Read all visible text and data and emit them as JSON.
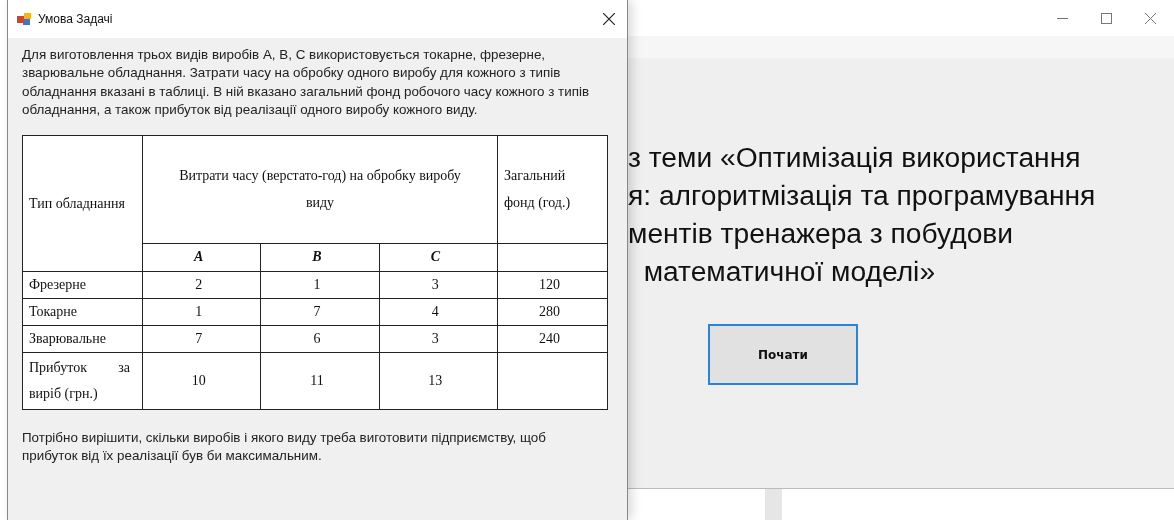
{
  "main_window": {
    "title_lines": [
      "з теми «Оптимізація використання",
      "я: алгоритмізація та програмування",
      "ментів тренажера з побудови",
      "  математичної моделі»"
    ],
    "start_button": "Почати"
  },
  "dialog": {
    "title": "Умова Задачі",
    "intro": "Для виготовлення трьох видів виробів  A, B, C використовується  токарне, фрезерне, зварювальне обладнання. Затрати часу на обробку  одного виробу для кожного з типів обладнання вказані в таблиці. В ній  вказано загальний фонд робочого часу кожного з типів обладнання, а також прибуток  від реалізації одного виробу кожного виду.",
    "table": {
      "type_header": "Тип обладнання",
      "cost_header": "Витрати часу (верстато-год) на обробку виробу виду",
      "fund_header": "Загальний фонд (год.)",
      "subcolumns": [
        "A",
        "B",
        "C"
      ],
      "rows": [
        {
          "name": "Фрезерне",
          "values": [
            "2",
            "1",
            "3"
          ],
          "fund": "120"
        },
        {
          "name": "Токарне",
          "values": [
            "1",
            "7",
            "4"
          ],
          "fund": "280"
        },
        {
          "name": "Зварювальне",
          "values": [
            "7",
            "6",
            "3"
          ],
          "fund": "240"
        },
        {
          "name": "Прибуток за виріб (грн.)",
          "values": [
            "10",
            "11",
            "13"
          ]
        }
      ]
    },
    "note": "Потрібно вирішити, скільки виробів і якого виду треба виготовити підприємству, щоб прибуток від їх реалізації був би максимальним."
  }
}
